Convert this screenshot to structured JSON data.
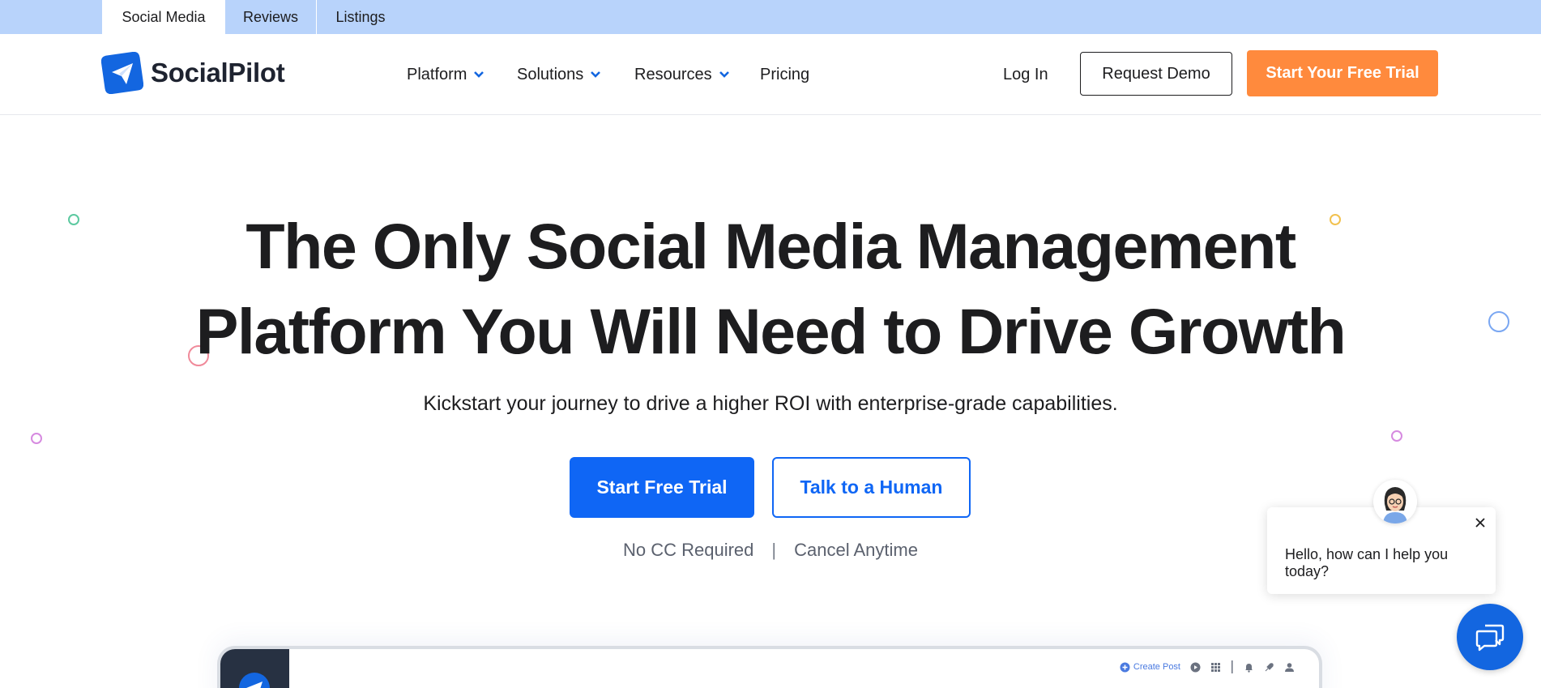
{
  "top_tabs": [
    {
      "label": "Social Media",
      "active": true
    },
    {
      "label": "Reviews",
      "active": false
    },
    {
      "label": "Listings",
      "active": false
    }
  ],
  "brand": {
    "name": "SocialPilot",
    "logo_icon": "paper-plane-icon",
    "color": "#1366e0"
  },
  "nav": {
    "items": [
      {
        "label": "Platform",
        "has_dropdown": true
      },
      {
        "label": "Solutions",
        "has_dropdown": true
      },
      {
        "label": "Resources",
        "has_dropdown": true
      },
      {
        "label": "Pricing",
        "has_dropdown": false
      }
    ],
    "login_label": "Log In",
    "demo_label": "Request Demo",
    "trial_label": "Start Your Free Trial"
  },
  "hero": {
    "title_line1": "The Only Social Media Management",
    "title_line2": "Platform You Will Need to Drive Growth",
    "subtitle": "Kickstart your journey to drive a higher ROI with enterprise-grade capabilities.",
    "primary_cta": "Start Free Trial",
    "secondary_cta": "Talk to a Human",
    "note_1": "No CC Required",
    "note_separator": "|",
    "note_2": "Cancel Anytime"
  },
  "preview": {
    "create_post_label": "Create Post"
  },
  "chat": {
    "message": "Hello, how can I help you today?"
  },
  "colors": {
    "accent_blue": "#0f66f5",
    "accent_orange": "#ff8a3d",
    "top_strip": "#b8d3fb"
  }
}
